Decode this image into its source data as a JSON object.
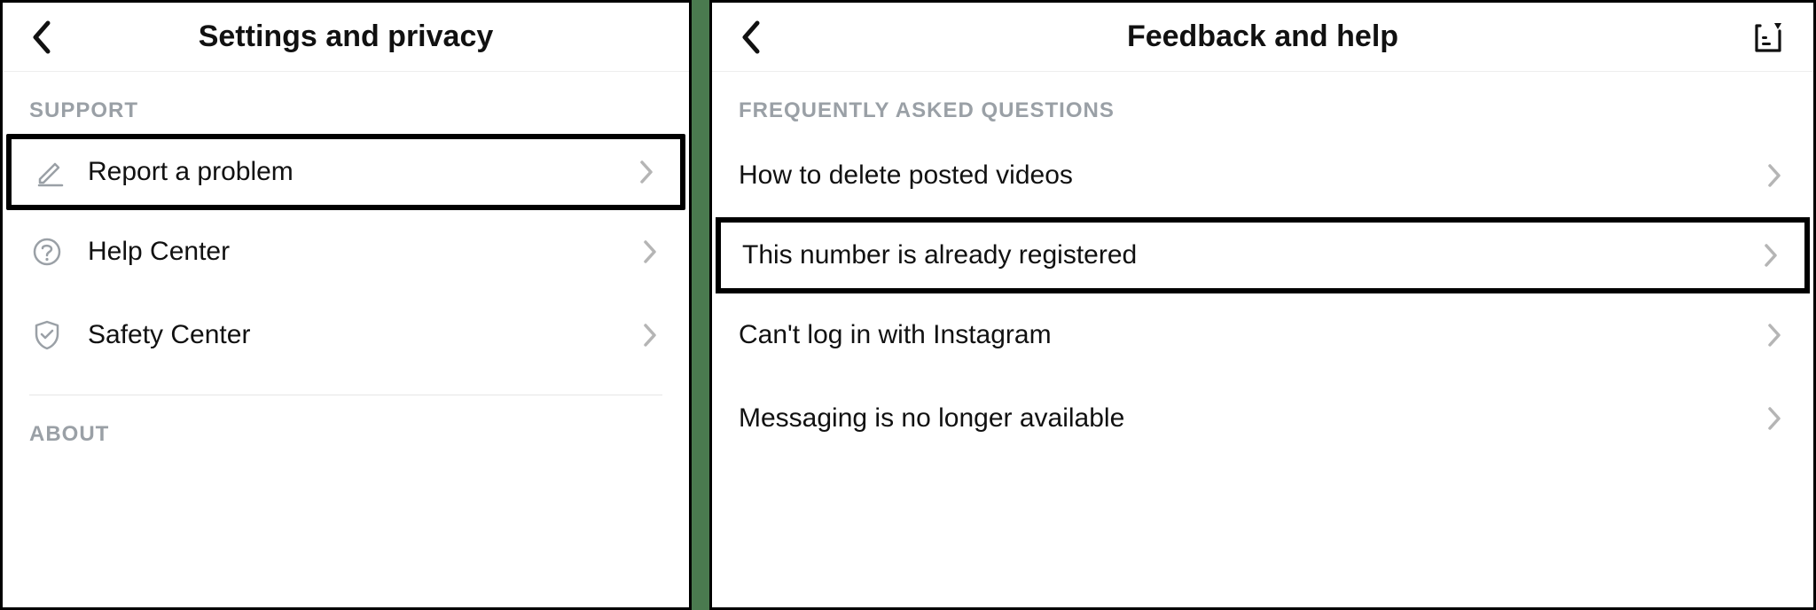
{
  "left": {
    "title": "Settings and privacy",
    "section_support": "SUPPORT",
    "section_about": "ABOUT",
    "items": [
      {
        "label": "Report a problem"
      },
      {
        "label": "Help Center"
      },
      {
        "label": "Safety Center"
      }
    ]
  },
  "right": {
    "title": "Feedback and help",
    "section_faq": "FREQUENTLY ASKED QUESTIONS",
    "items": [
      {
        "label": "How to delete posted videos"
      },
      {
        "label": "This number is already registered"
      },
      {
        "label": "Can't log in with Instagram"
      },
      {
        "label": "Messaging is no longer available"
      }
    ]
  }
}
